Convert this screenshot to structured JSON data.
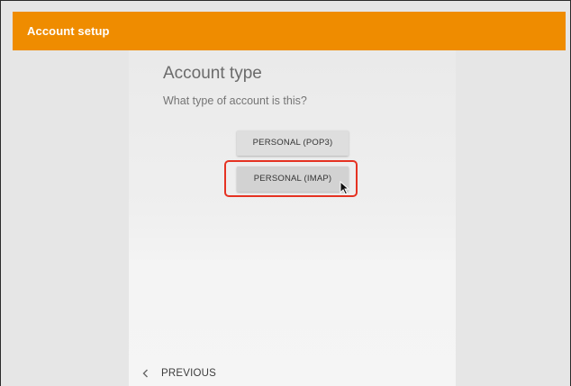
{
  "app": {
    "title": "Account setup",
    "accent_color": "#ef8c00"
  },
  "page": {
    "heading": "Account type",
    "question": "What type of account is this?"
  },
  "options": [
    {
      "label": "PERSONAL (POP3)"
    },
    {
      "label": "PERSONAL (IMAP)",
      "highlighted": true
    }
  ],
  "footer": {
    "previous_label": "PREVIOUS",
    "previous_icon": "chevron-left-icon"
  },
  "highlight_color": "#e53222",
  "cursor_icon": "mouse-pointer-icon"
}
